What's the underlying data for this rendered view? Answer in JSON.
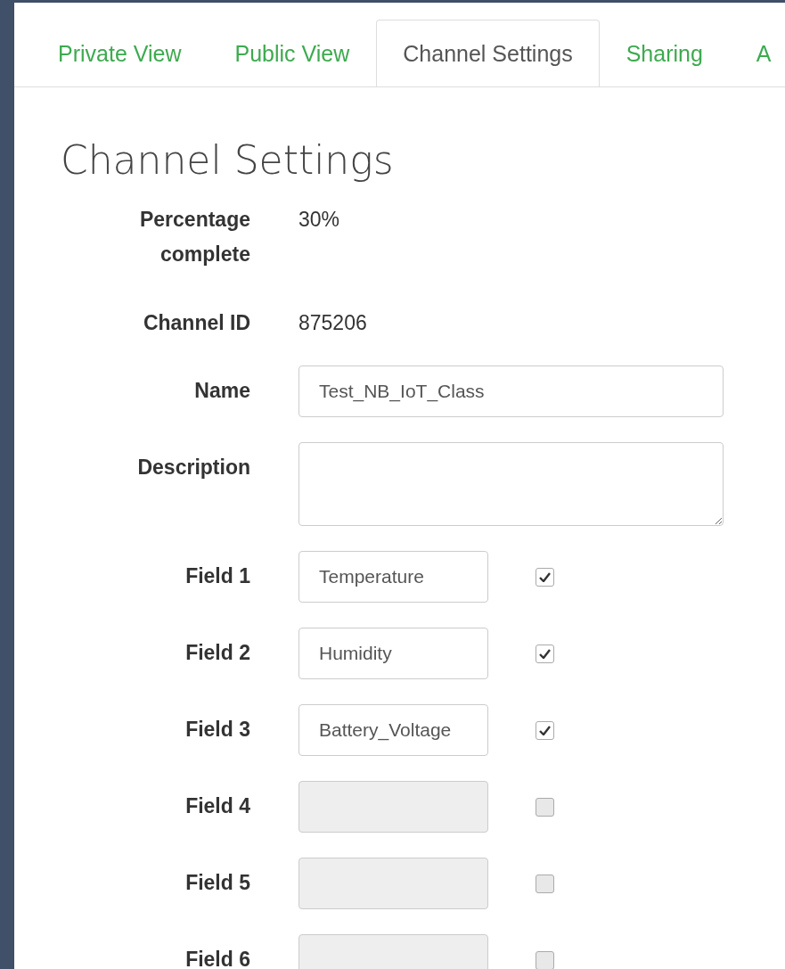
{
  "tabs": [
    {
      "label": "Private View",
      "selected": false
    },
    {
      "label": "Public View",
      "selected": false
    },
    {
      "label": "Channel Settings",
      "selected": true
    },
    {
      "label": "Sharing",
      "selected": false
    },
    {
      "label": "A",
      "selected": false
    }
  ],
  "heading": "Channel Settings",
  "info": [
    {
      "label": "Percentage complete",
      "value": "30%"
    },
    {
      "label": "Channel ID",
      "value": "875206"
    }
  ],
  "name": {
    "label": "Name",
    "value": "Test_NB_IoT_Class"
  },
  "description": {
    "label": "Description"
  },
  "fields": [
    {
      "label": "Field 1",
      "value": "Temperature",
      "disabled": false,
      "checked": true
    },
    {
      "label": "Field 2",
      "value": "Humidity",
      "disabled": false,
      "checked": true
    },
    {
      "label": "Field 3",
      "value": "Battery_Voltage",
      "disabled": false,
      "checked": true
    },
    {
      "label": "Field 4",
      "disabled": true,
      "checked": false
    },
    {
      "label": "Field 5",
      "disabled": true,
      "checked": false
    },
    {
      "label": "Field 6",
      "disabled": true,
      "checked": false
    }
  ]
}
